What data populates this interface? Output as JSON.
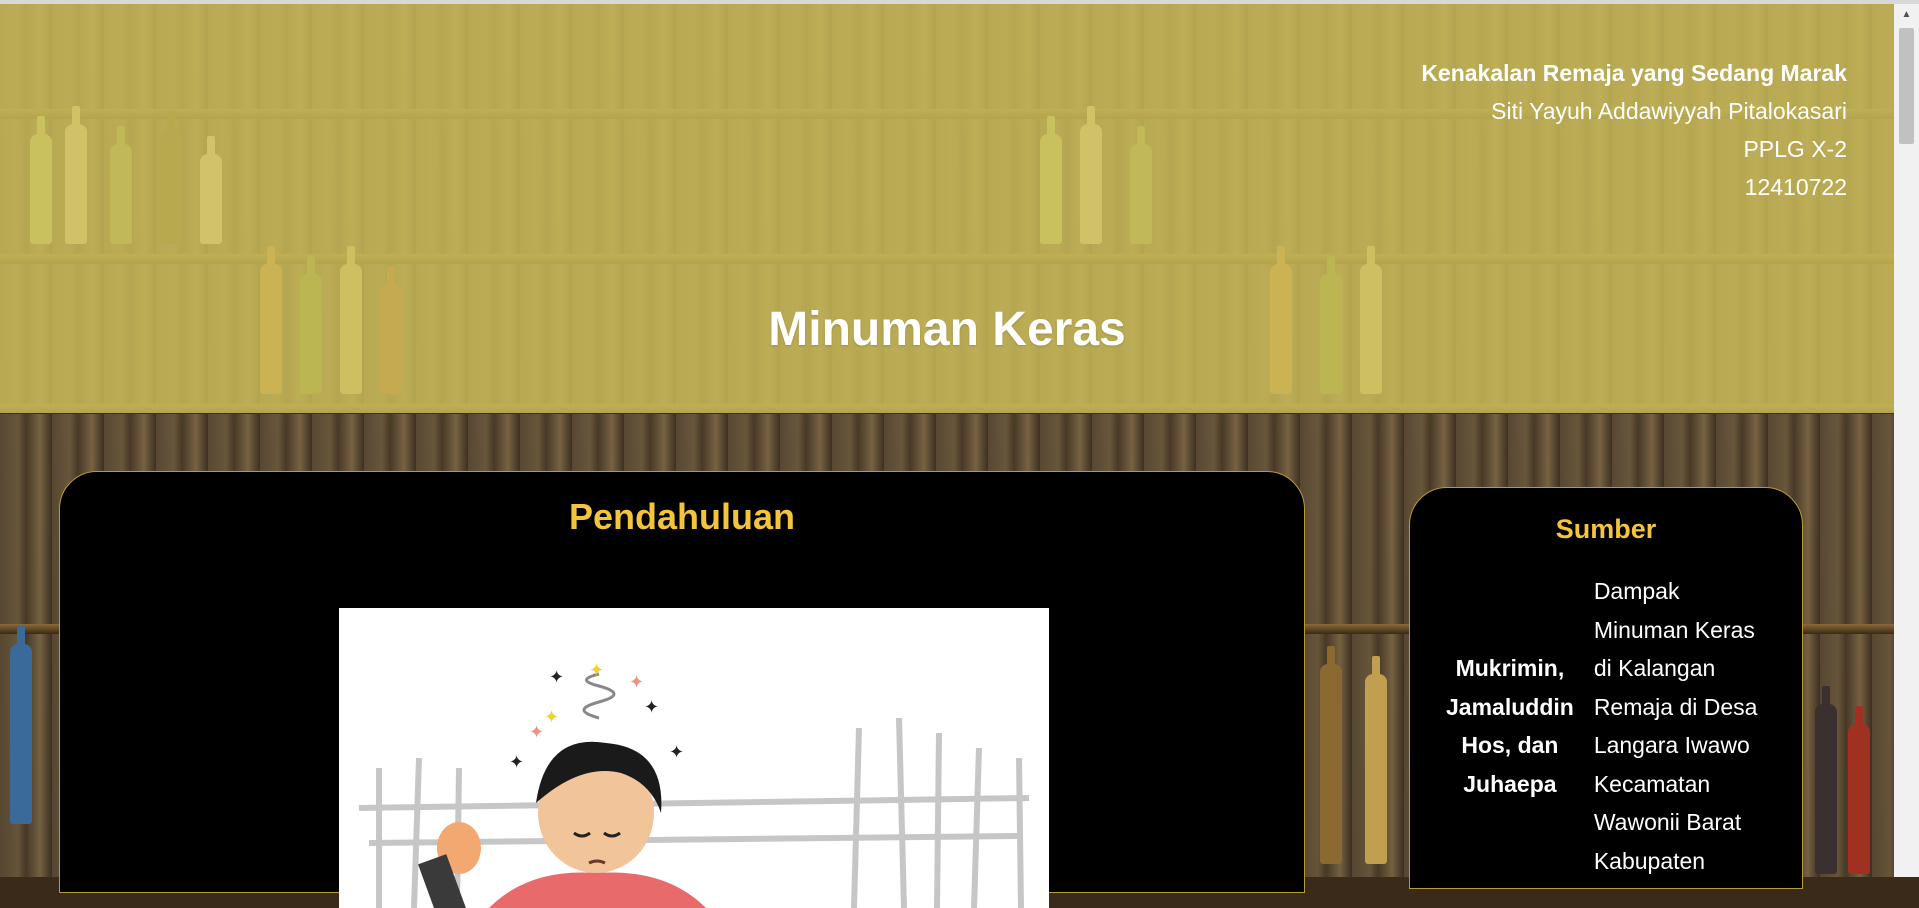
{
  "header": {
    "article_title": "Kenakalan Remaja yang Sedang Marak",
    "author": "Siti Yayuh Addawiyyah Pitalokasari",
    "class": "PPLG X-2",
    "student_id": "12410722"
  },
  "main": {
    "title": "Minuman Keras",
    "section_heading": "Pendahuluan"
  },
  "sumber": {
    "heading": "Sumber",
    "authors": "Mukrimin, Jamaluddin Hos, dan Juhaepa",
    "reference": "Dampak Minuman Keras di Kalangan Remaja di Desa Langara Iwawo Kecamatan Wawonii Barat Kabupaten"
  },
  "colors": {
    "accent": "#f3c43c",
    "header_overlay": "#cdbe5a",
    "panel_bg": "#000000",
    "panel_border": "#b89a38"
  },
  "icons": {
    "scroll_up": "triangle-up-icon"
  }
}
